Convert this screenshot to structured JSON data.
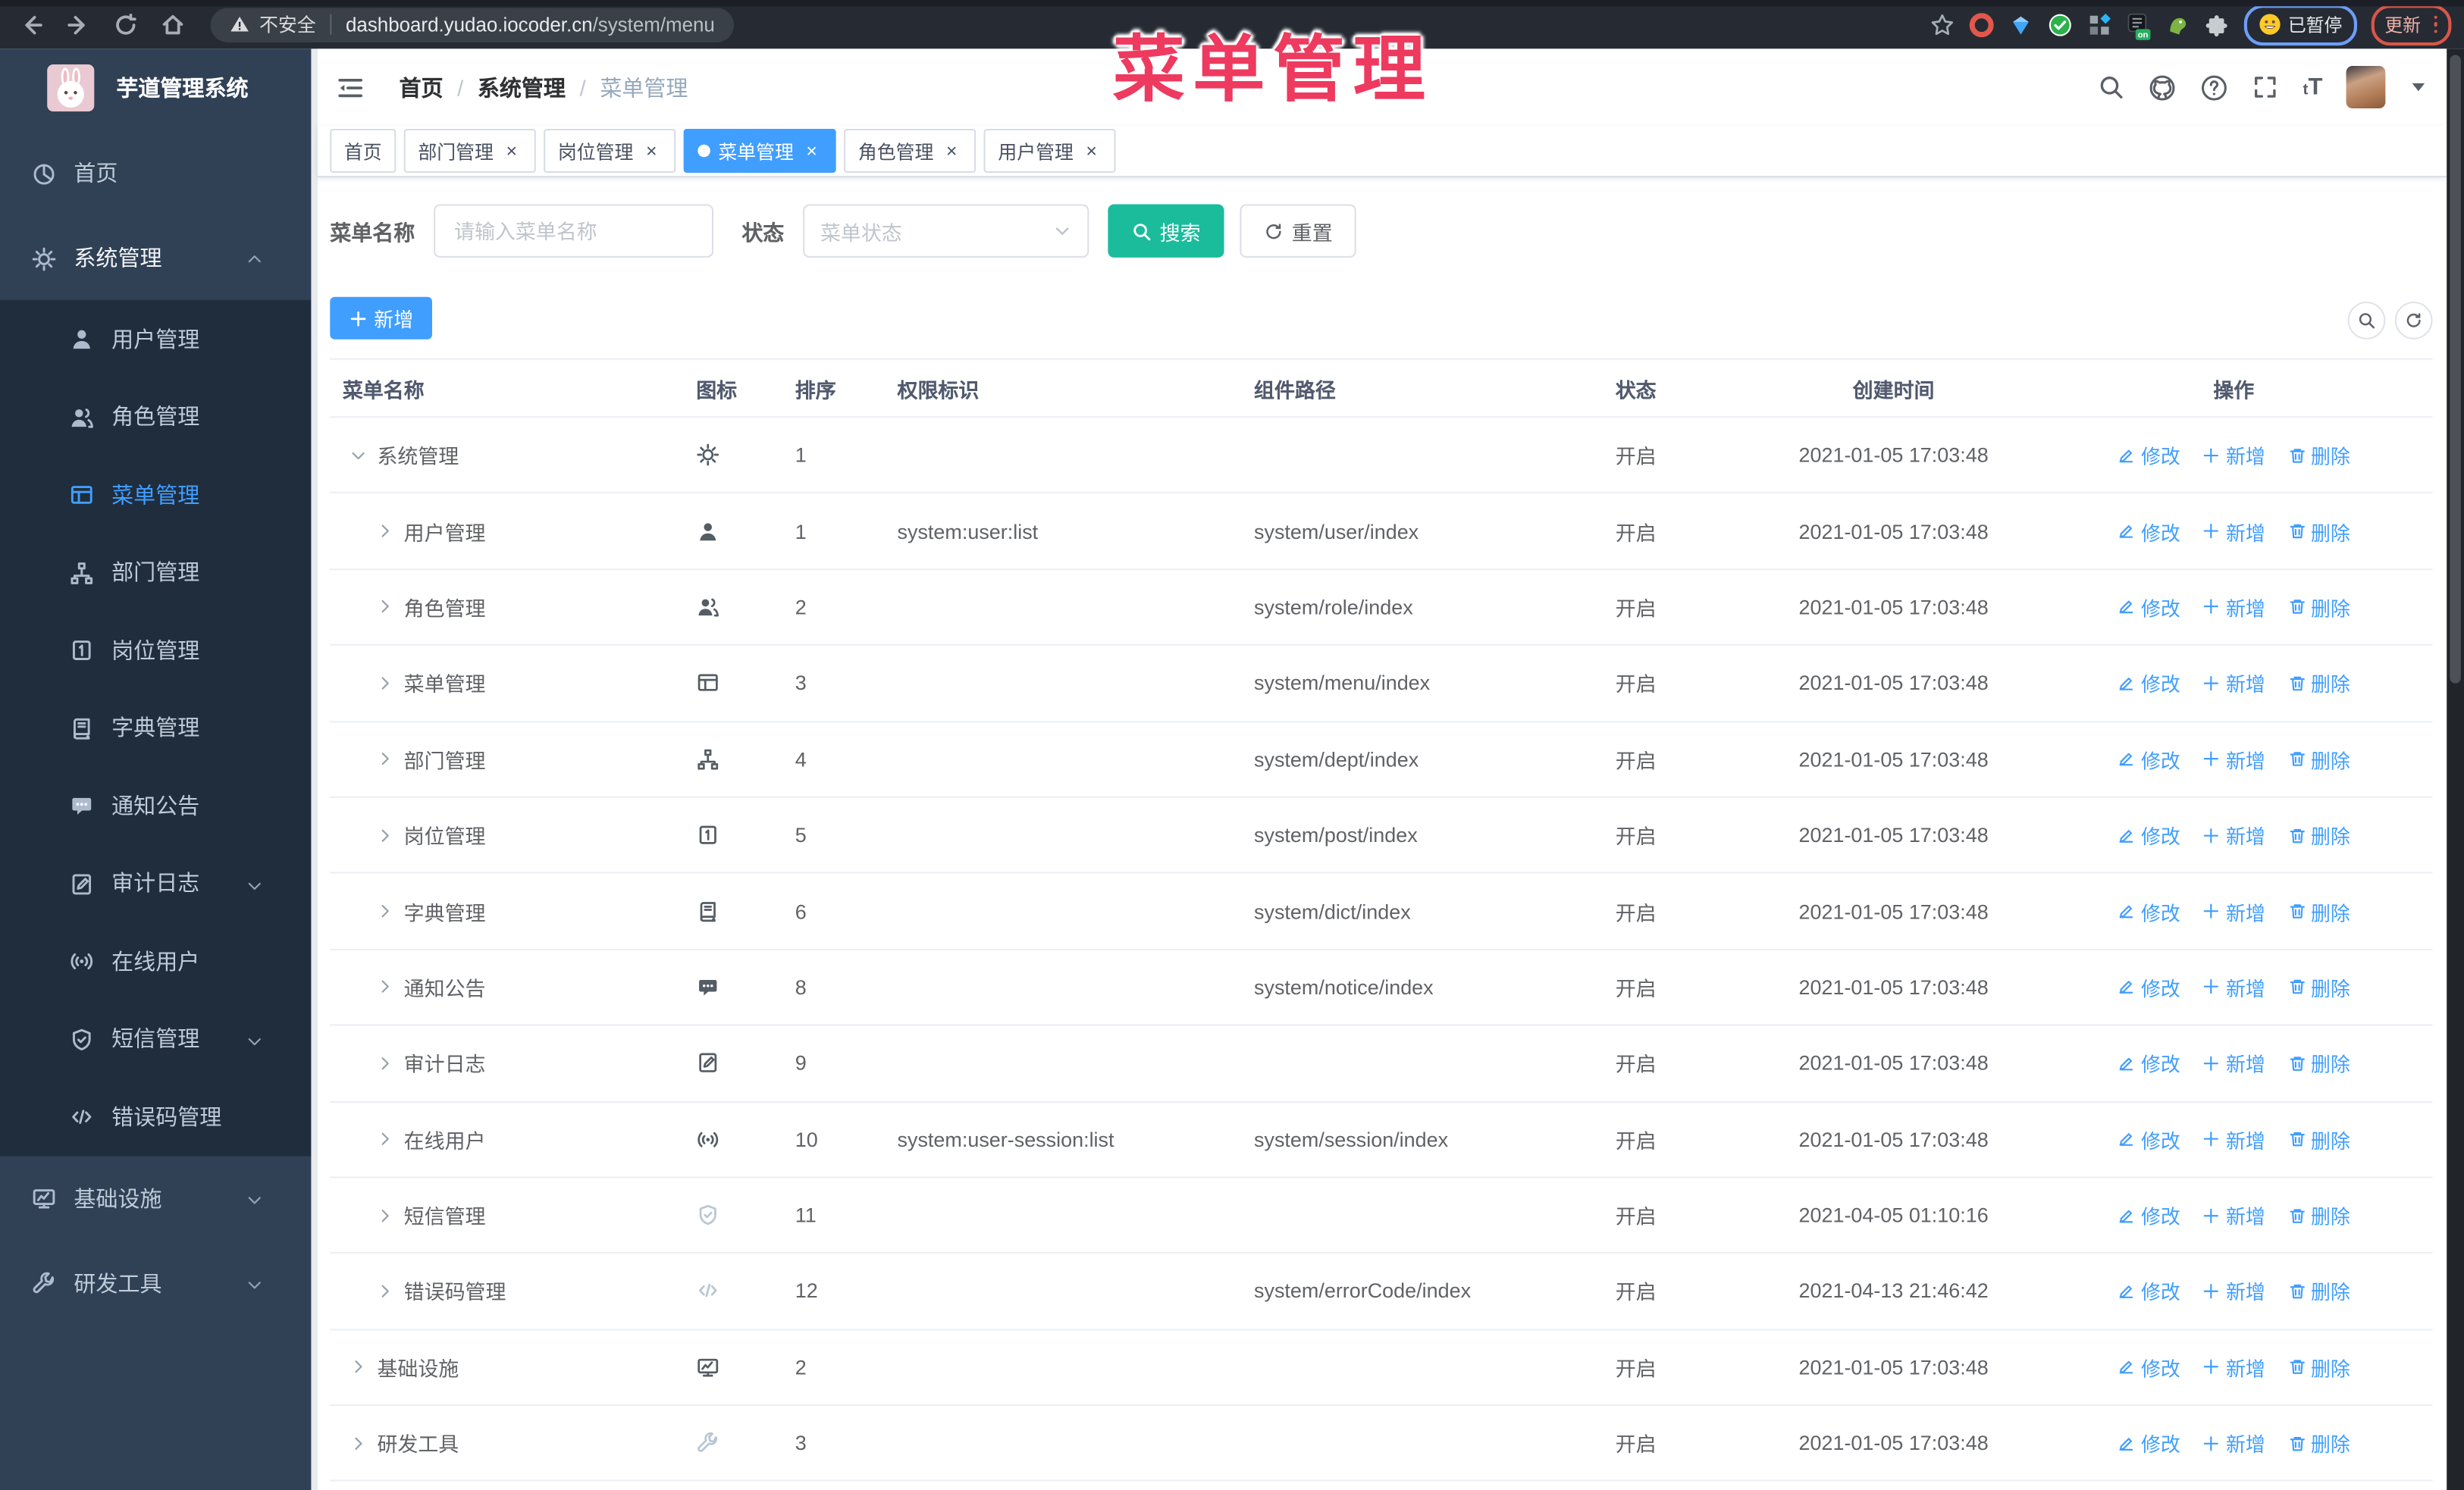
{
  "overlay_title": "菜单管理",
  "browser": {
    "security_label": "不安全",
    "url_host": "dashboard.yudao.iocoder.cn",
    "url_path": "/system/menu",
    "profile_label": "已暂停",
    "update_label": "更新"
  },
  "sidebar": {
    "app_title": "芋道管理系统",
    "items": [
      {
        "key": "home",
        "label": "首页",
        "icon": "pie",
        "level": 0
      },
      {
        "key": "system",
        "label": "系统管理",
        "icon": "gear",
        "level": 0,
        "caret": "up",
        "active_parent": true
      },
      {
        "key": "user",
        "label": "用户管理",
        "icon": "user",
        "level": 1
      },
      {
        "key": "role",
        "label": "角色管理",
        "icon": "users",
        "level": 1
      },
      {
        "key": "menu",
        "label": "菜单管理",
        "icon": "menu",
        "level": 1,
        "active": true
      },
      {
        "key": "dept",
        "label": "部门管理",
        "icon": "tree",
        "level": 1
      },
      {
        "key": "post",
        "label": "岗位管理",
        "icon": "badge",
        "level": 1
      },
      {
        "key": "dict",
        "label": "字典管理",
        "icon": "book",
        "level": 1
      },
      {
        "key": "notice",
        "label": "通知公告",
        "icon": "message",
        "level": 1
      },
      {
        "key": "audit-log",
        "label": "审计日志",
        "icon": "log",
        "level": 1,
        "caret": "down"
      },
      {
        "key": "online-user",
        "label": "在线用户",
        "icon": "online",
        "level": 1
      },
      {
        "key": "sms",
        "label": "短信管理",
        "icon": "shield",
        "level": 1,
        "caret": "down"
      },
      {
        "key": "error-code",
        "label": "错误码管理",
        "icon": "code",
        "level": 1
      },
      {
        "key": "infra",
        "label": "基础设施",
        "icon": "monitor",
        "level": 0,
        "caret": "down"
      },
      {
        "key": "dev-tool",
        "label": "研发工具",
        "icon": "tool",
        "level": 0,
        "caret": "down"
      }
    ]
  },
  "header": {
    "breadcrumb": [
      "首页",
      "系统管理",
      "菜单管理"
    ]
  },
  "tags": [
    {
      "label": "首页",
      "closable": false,
      "active": false
    },
    {
      "label": "部门管理",
      "closable": true,
      "active": false
    },
    {
      "label": "岗位管理",
      "closable": true,
      "active": false
    },
    {
      "label": "菜单管理",
      "closable": true,
      "active": true
    },
    {
      "label": "角色管理",
      "closable": true,
      "active": false
    },
    {
      "label": "用户管理",
      "closable": true,
      "active": false
    }
  ],
  "filters": {
    "name_label": "菜单名称",
    "name_placeholder": "请输入菜单名称",
    "status_label": "状态",
    "status_placeholder": "菜单状态",
    "search_label": "搜索",
    "reset_label": "重置"
  },
  "toolbar": {
    "add_label": "新增"
  },
  "table": {
    "columns": [
      "菜单名称",
      "图标",
      "排序",
      "权限标识",
      "组件路径",
      "状态",
      "创建时间",
      "操作"
    ],
    "action_labels": [
      "修改",
      "新增",
      "删除"
    ],
    "rows": [
      {
        "name": "系统管理",
        "icon": "gear",
        "level": 0,
        "expanded": true,
        "order": "1",
        "perm": "",
        "path": "",
        "status": "开启",
        "created": "2021-01-05 17:03:48"
      },
      {
        "name": "用户管理",
        "icon": "user",
        "level": 1,
        "order": "1",
        "perm": "system:user:list",
        "path": "system/user/index",
        "status": "开启",
        "created": "2021-01-05 17:03:48"
      },
      {
        "name": "角色管理",
        "icon": "users",
        "level": 1,
        "order": "2",
        "perm": "",
        "path": "system/role/index",
        "status": "开启",
        "created": "2021-01-05 17:03:48"
      },
      {
        "name": "菜单管理",
        "icon": "menu",
        "level": 1,
        "order": "3",
        "perm": "",
        "path": "system/menu/index",
        "status": "开启",
        "created": "2021-01-05 17:03:48"
      },
      {
        "name": "部门管理",
        "icon": "tree",
        "level": 1,
        "order": "4",
        "perm": "",
        "path": "system/dept/index",
        "status": "开启",
        "created": "2021-01-05 17:03:48"
      },
      {
        "name": "岗位管理",
        "icon": "badge",
        "level": 1,
        "order": "5",
        "perm": "",
        "path": "system/post/index",
        "status": "开启",
        "created": "2021-01-05 17:03:48"
      },
      {
        "name": "字典管理",
        "icon": "book",
        "level": 1,
        "order": "6",
        "perm": "",
        "path": "system/dict/index",
        "status": "开启",
        "created": "2021-01-05 17:03:48"
      },
      {
        "name": "通知公告",
        "icon": "message",
        "level": 1,
        "order": "8",
        "perm": "",
        "path": "system/notice/index",
        "status": "开启",
        "created": "2021-01-05 17:03:48"
      },
      {
        "name": "审计日志",
        "icon": "log",
        "level": 1,
        "order": "9",
        "perm": "",
        "path": "",
        "status": "开启",
        "created": "2021-01-05 17:03:48"
      },
      {
        "name": "在线用户",
        "icon": "online",
        "level": 1,
        "order": "10",
        "perm": "system:user-session:list",
        "path": "system/session/index",
        "status": "开启",
        "created": "2021-01-05 17:03:48"
      },
      {
        "name": "短信管理",
        "icon": "shield",
        "muted": true,
        "level": 1,
        "order": "11",
        "perm": "",
        "path": "",
        "status": "开启",
        "created": "2021-04-05 01:10:16"
      },
      {
        "name": "错误码管理",
        "icon": "code",
        "muted": true,
        "level": 1,
        "order": "12",
        "perm": "",
        "path": "system/errorCode/index",
        "status": "开启",
        "created": "2021-04-13 21:46:42"
      },
      {
        "name": "基础设施",
        "icon": "monitor",
        "level": 0,
        "order": "2",
        "perm": "",
        "path": "",
        "status": "开启",
        "created": "2021-01-05 17:03:48"
      },
      {
        "name": "研发工具",
        "icon": "tool",
        "muted": true,
        "level": 0,
        "order": "3",
        "perm": "",
        "path": "",
        "status": "开启",
        "created": "2021-01-05 17:03:48"
      }
    ]
  }
}
